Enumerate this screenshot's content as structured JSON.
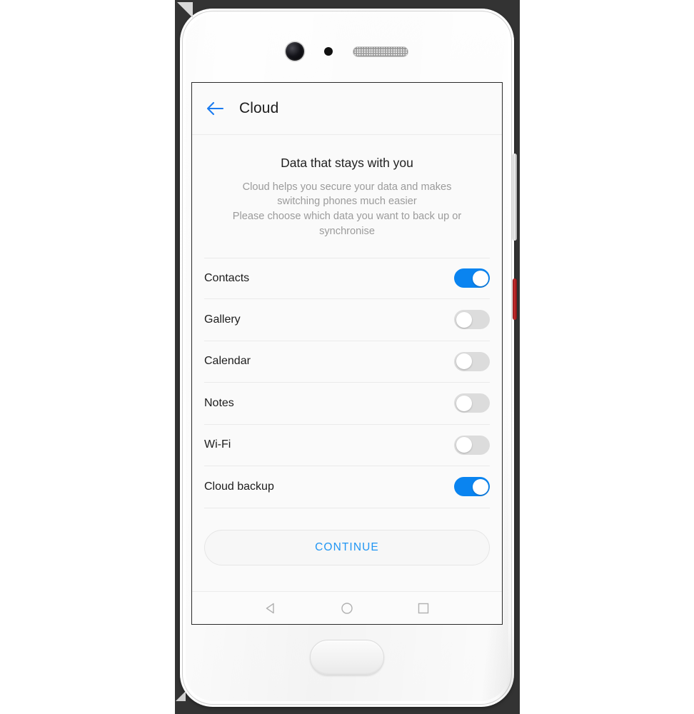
{
  "app": {
    "bar": {
      "back_icon": "back-arrow-icon",
      "title": "Cloud"
    }
  },
  "intro": {
    "heading": "Data that stays with you",
    "description": "Cloud helps you secure your data and makes switching phones much easier Please choose which data you want to back up or synchronise",
    "description_lines": [
      "Cloud helps you secure your data and makes",
      "switching phones much easier",
      "Please choose which data you want to back up or",
      "synchronise"
    ]
  },
  "settings": {
    "rows": [
      {
        "label": "Contacts",
        "state": "on"
      },
      {
        "label": "Gallery",
        "state": "off"
      },
      {
        "label": "Calendar",
        "state": "off"
      },
      {
        "label": "Notes",
        "state": "off"
      },
      {
        "label": "Wi-Fi",
        "state": "off"
      },
      {
        "label": "Cloud backup",
        "state": "on"
      }
    ]
  },
  "actions": {
    "continue_label": "CONTINUE"
  },
  "navigation_bar": {
    "buttons": [
      {
        "name": "back-nav-icon",
        "glyph": "triangle-left"
      },
      {
        "name": "home-nav-icon",
        "glyph": "circle"
      },
      {
        "name": "recents-nav-icon",
        "glyph": "square"
      }
    ]
  },
  "hardware": {
    "front_camera": "front-camera",
    "proximity_sensor": "proximity-sensor",
    "earpiece": "earpiece-speaker",
    "volume_rocker": "volume-rocker",
    "power_button": "power-button",
    "home_button": "home-button"
  },
  "colors": {
    "accent_blue": "#0a84f0",
    "link_blue": "#2196f3",
    "toggle_off": "#dcdcdc",
    "screen_bg": "#fafafa",
    "backdrop": "#333333",
    "muted_text": "#9b9b9b"
  }
}
